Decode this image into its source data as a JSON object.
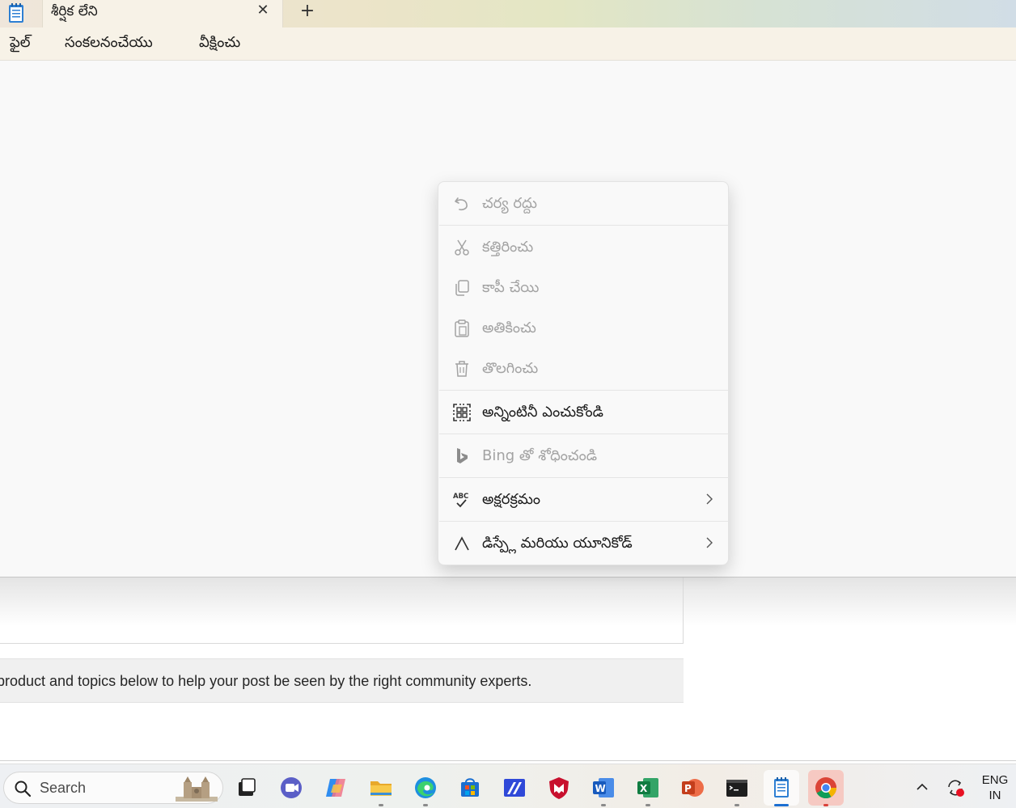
{
  "window": {
    "tab_title": "శీర్షిక లేని",
    "menu": [
      "ఫైల్",
      "సంకలనంచేయు",
      "వీక్షించు"
    ]
  },
  "context_menu": {
    "items": [
      {
        "label": "చర్య రద్దు",
        "icon": "undo-icon",
        "enabled": false
      },
      {
        "label": "కత్తిరించు",
        "icon": "scissors-icon",
        "enabled": false
      },
      {
        "label": "కాపీ చేయి",
        "icon": "copy-icon",
        "enabled": false
      },
      {
        "label": "అతికించు",
        "icon": "paste-icon",
        "enabled": false
      },
      {
        "label": "తొలగించు",
        "icon": "trash-icon",
        "enabled": false
      },
      {
        "label": "అన్నింటినీ ఎంచుకోండి",
        "icon": "select-all-icon",
        "enabled": true
      },
      {
        "label": "Bing తో శోధించండి",
        "icon": "bing-icon",
        "enabled": false
      },
      {
        "label": "అక్షరక్రమం",
        "icon": "spellcheck-icon",
        "enabled": true,
        "submenu": true
      },
      {
        "label": "డిస్ప్లే మరియు యూనికోడ్",
        "icon": "caret-icon",
        "enabled": true,
        "submenu": true
      }
    ]
  },
  "background_page": {
    "banner_text": "product and topics below to help your post be seen by the right community experts."
  },
  "taskbar": {
    "search_placeholder": "Search",
    "apps": [
      "task-view",
      "teams",
      "copilot",
      "file-explorer",
      "edge",
      "store",
      "app-blue",
      "mcafee",
      "word",
      "excel",
      "powerpoint",
      "terminal",
      "notepad",
      "chrome"
    ],
    "language": {
      "line1": "ENG",
      "line2": "IN"
    }
  }
}
